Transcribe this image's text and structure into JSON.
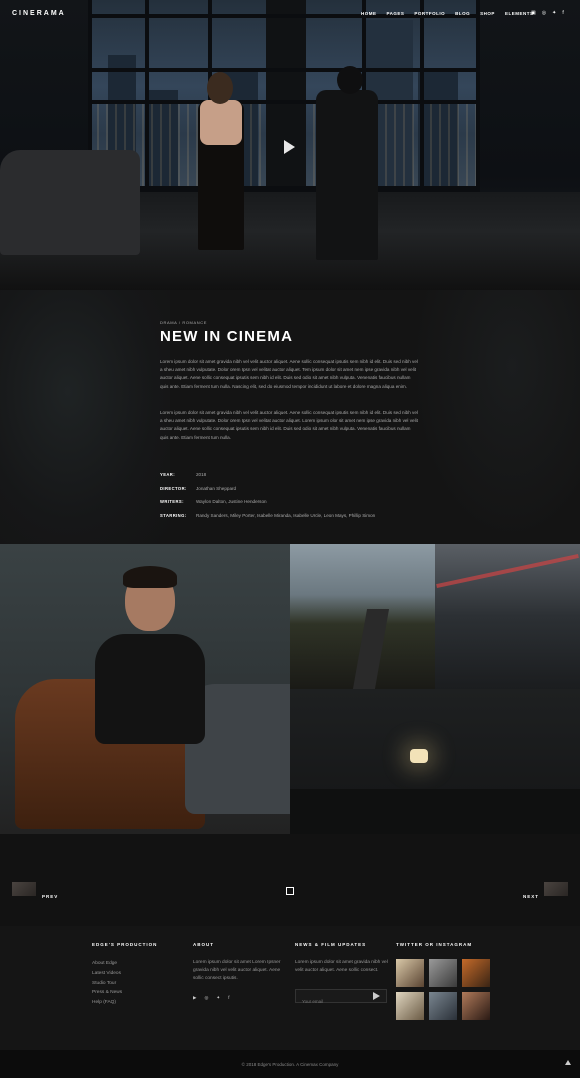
{
  "brand": {
    "logo": "CINERAMA"
  },
  "nav": {
    "items": [
      "HOME",
      "PAGES",
      "PORTFOLIO",
      "BLOG",
      "SHOP",
      "ELEMENTS"
    ]
  },
  "header_social": [
    "▣",
    "◎",
    "✦",
    "f"
  ],
  "hero": {
    "play_icon": "play-icon"
  },
  "movie": {
    "genre": "DRAMA / ROMANCE",
    "title": "NEW IN CINEMA",
    "paragraph1": "Lorem ipsum dolor sit amet gravida nibh vel velit auctor aliquet. Aene sollic consequat ipsutis sem nibh id elit. Duis sed nibh vel a sheu amet nibh vulputate. Dolor orem Ipsn vel velitat auctor aliquet. Tem ipsum dolor sit amet nem ipse gravida nibh vel velit auctor aliquet. Aene sollic consequat ipsutis sem nibh id elit. Duis sed odio sit amet nibh vulputa. Venenatis faucibus nullam quis ante. Etiam ferment tum nulla. Nascing elit, sed do eiusmod tempor incididunt ut labore et dolore magna aliqua enim.",
    "paragraph2": "Lorem ipsum dolor sit amet gravida nibh vel velit auctor aliquet. Aene sollic consequat ipsutis sem nibh id elit. Duis sed nibh vel a sheu amet nibh vulputate. Dolor orem Ipsn vel velitat auctor aliquet. Lorem ipsum olor sit amet nem ipse gravida nibh vel velit auctor aliquet. Aene sollic consequat ipsutis sem nibh id elit. Duis sed odio sit amet nibh vulputa. Venenatis faucibus nullam quis ante. Etiam ferment tum nulla.",
    "meta": [
      {
        "key": "YEAR:",
        "value": "2018"
      },
      {
        "key": "DIRECTOR:",
        "value": "Jonathan Sheppard"
      },
      {
        "key": "WRITERS:",
        "value": "Waylon Dalton, Justine Henderson"
      },
      {
        "key": "STARRING:",
        "value": "Randy Sanders, Miley Porter, Isabelle Miranda, Isabelle Urcle, Leon Mays, Phillip Simon"
      }
    ]
  },
  "pager": {
    "prev": "PREV",
    "next": "NEXT"
  },
  "footer": {
    "col1": {
      "heading": "EDGE'S PRODUCTION",
      "links": [
        "About Edge",
        "Latest Videos",
        "Studio Tour",
        "Press & News",
        "Help (FAQ)"
      ]
    },
    "col2": {
      "heading": "ABOUT",
      "text": "Lorem ipsum dolor sit amet Lorem Ipsner gravida nibh vel velit auctor aliquet. Aene sollic consect ipsutis.",
      "social": [
        "▶",
        "◎",
        "✦",
        "f"
      ]
    },
    "col3": {
      "heading": "NEWS & FILM UPDATES",
      "text": "Lorem ipsum dolor sit amet gravida nibh vel velit auctor aliquet. Aene sollic consect.",
      "email_placeholder": "Your email"
    },
    "col4": {
      "heading": "TWITTER OR INSTAGRAM"
    },
    "copyright": "© 2018 Edge's Production. A Cinemax Company"
  },
  "colors": {
    "background": "#111111",
    "accent": "#ffffff"
  }
}
